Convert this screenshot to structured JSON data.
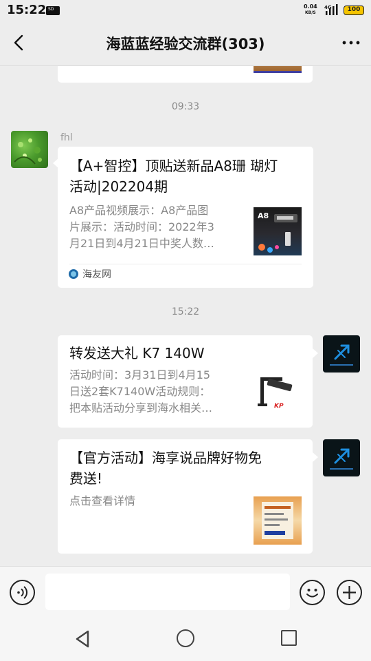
{
  "status_bar": {
    "time": "15:22",
    "sd_label": "SD",
    "net_speed_value": "0.04",
    "net_speed_unit": "KB/S",
    "network_type": "4G",
    "battery": "100"
  },
  "header": {
    "title": "海蓝蓝经验交流群(303)"
  },
  "messages": [
    {
      "timestamp": "09:33",
      "sender": "fhl",
      "card": {
        "title_line1": "【A+智控】顶贴送新品A8珊 瑚灯",
        "title_line2": "活动|202204期",
        "desc_line1": "A8产品视频展示：A8产品图",
        "desc_line2": "片展示：活动时间：2022年3",
        "desc_line3": "月21日到4月21日中奖人数…",
        "thumb_label": "A8",
        "source": "海友网"
      }
    },
    {
      "timestamp": "15:22",
      "card": {
        "title": "转发送大礼 K7 140W",
        "desc_line1": "活动时间：3月31日到4月15",
        "desc_line2": "日送2套K7140W活动规则：",
        "desc_line3": "把本贴活动分享到海水相关…"
      }
    },
    {
      "card": {
        "title_line1": "【官方活动】海享说品牌好物免",
        "title_line2": "费送!",
        "desc_line1": "点击查看详情"
      }
    }
  ],
  "input": {
    "value": "",
    "placeholder": ""
  },
  "colors": {
    "background": "#ededed",
    "card": "#ffffff",
    "self_avatar": "#0a1a2a",
    "accent_blue": "#1e8fe0"
  }
}
